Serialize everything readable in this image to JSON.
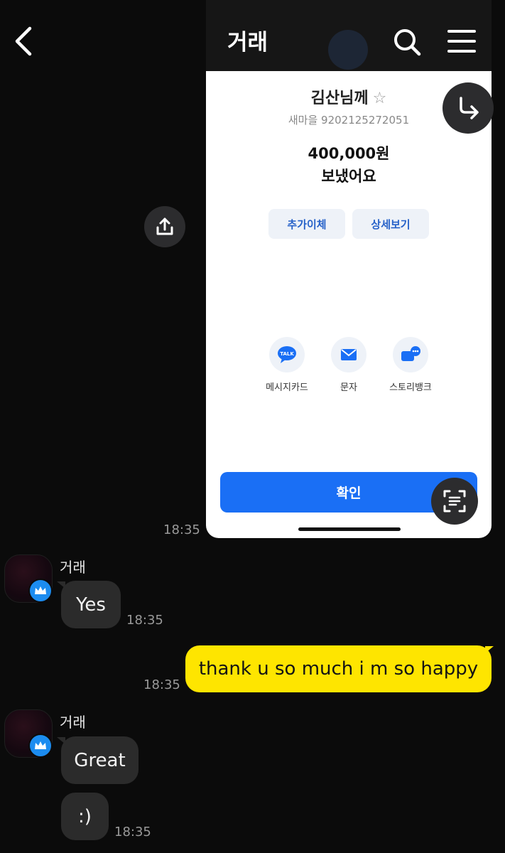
{
  "header": {
    "back_icon": "chevron-left-icon"
  },
  "shared_image": {
    "app_title": "거래",
    "recipient": "김산님께",
    "star": "☆",
    "account": "새마을 9202125272051",
    "amount": "400,000원",
    "status": "보냈어요",
    "buttons": [
      "추가이체",
      "상세보기"
    ],
    "share_options": [
      {
        "label": "메시지카드",
        "icon": "talk-bubble-icon"
      },
      {
        "label": "문자",
        "icon": "envelope-icon"
      },
      {
        "label": "스토리뱅크",
        "icon": "story-bank-icon"
      }
    ],
    "confirm": "확인",
    "time": "18:35",
    "talk_badge": "TALK"
  },
  "messages": [
    {
      "direction": "in",
      "sender": "거래",
      "text": "Yes",
      "time": "18:35"
    },
    {
      "direction": "out",
      "text": "thank u so much i m so happy",
      "time": "18:35"
    },
    {
      "direction": "in",
      "sender": "거래",
      "text": "Great"
    },
    {
      "direction": "in",
      "text": ":)",
      "time": "18:35"
    }
  ],
  "colors": {
    "background": "#0b0b0b",
    "incoming_bubble": "#2b2b2b",
    "outgoing_bubble": "#fee500",
    "badge": "#1c8cf0",
    "confirm_button": "#1a6ff5"
  }
}
